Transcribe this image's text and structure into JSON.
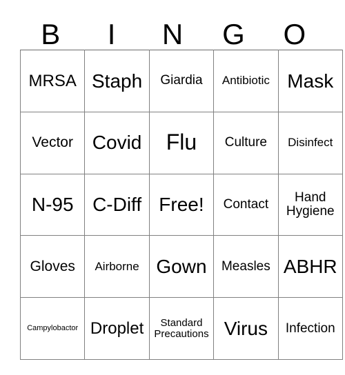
{
  "card": {
    "title": "BINGO",
    "header_letters": [
      "B",
      "I",
      "N",
      "G",
      "O"
    ],
    "rows": [
      [
        {
          "label": "MRSA",
          "size": "fs-l"
        },
        {
          "label": "Staph",
          "size": "fs-xl"
        },
        {
          "label": "Giardia",
          "size": "fs-m"
        },
        {
          "label": "Antibiotic",
          "size": "fs-sm"
        },
        {
          "label": "Mask",
          "size": "fs-xl"
        }
      ],
      [
        {
          "label": "Vector",
          "size": "fs-ml"
        },
        {
          "label": "Covid",
          "size": "fs-xl"
        },
        {
          "label": "Flu",
          "size": "fs-xxl"
        },
        {
          "label": "Culture",
          "size": "fs-m"
        },
        {
          "label": "Disinfect",
          "size": "fs-sm"
        }
      ],
      [
        {
          "label": "N-95",
          "size": "fs-xl"
        },
        {
          "label": "C-Diff",
          "size": "fs-xl"
        },
        {
          "label": "Free!",
          "size": "fs-xl"
        },
        {
          "label": "Contact",
          "size": "fs-m"
        },
        {
          "label": "Hand Hygiene",
          "size": "fs-m"
        }
      ],
      [
        {
          "label": "Gloves",
          "size": "fs-ml"
        },
        {
          "label": "Airborne",
          "size": "fs-sm"
        },
        {
          "label": "Gown",
          "size": "fs-xl"
        },
        {
          "label": "Measles",
          "size": "fs-m"
        },
        {
          "label": "ABHR",
          "size": "fs-xl"
        }
      ],
      [
        {
          "label": "Campylobactor",
          "size": "fs-xs"
        },
        {
          "label": "Droplet",
          "size": "fs-l"
        },
        {
          "label": "Standard Precautions",
          "size": "fs-s"
        },
        {
          "label": "Virus",
          "size": "fs-xl"
        },
        {
          "label": "Infection",
          "size": "fs-m"
        }
      ]
    ]
  },
  "colors": {
    "background": "#ffffff",
    "text": "#000000",
    "grid_line": "#808080"
  }
}
